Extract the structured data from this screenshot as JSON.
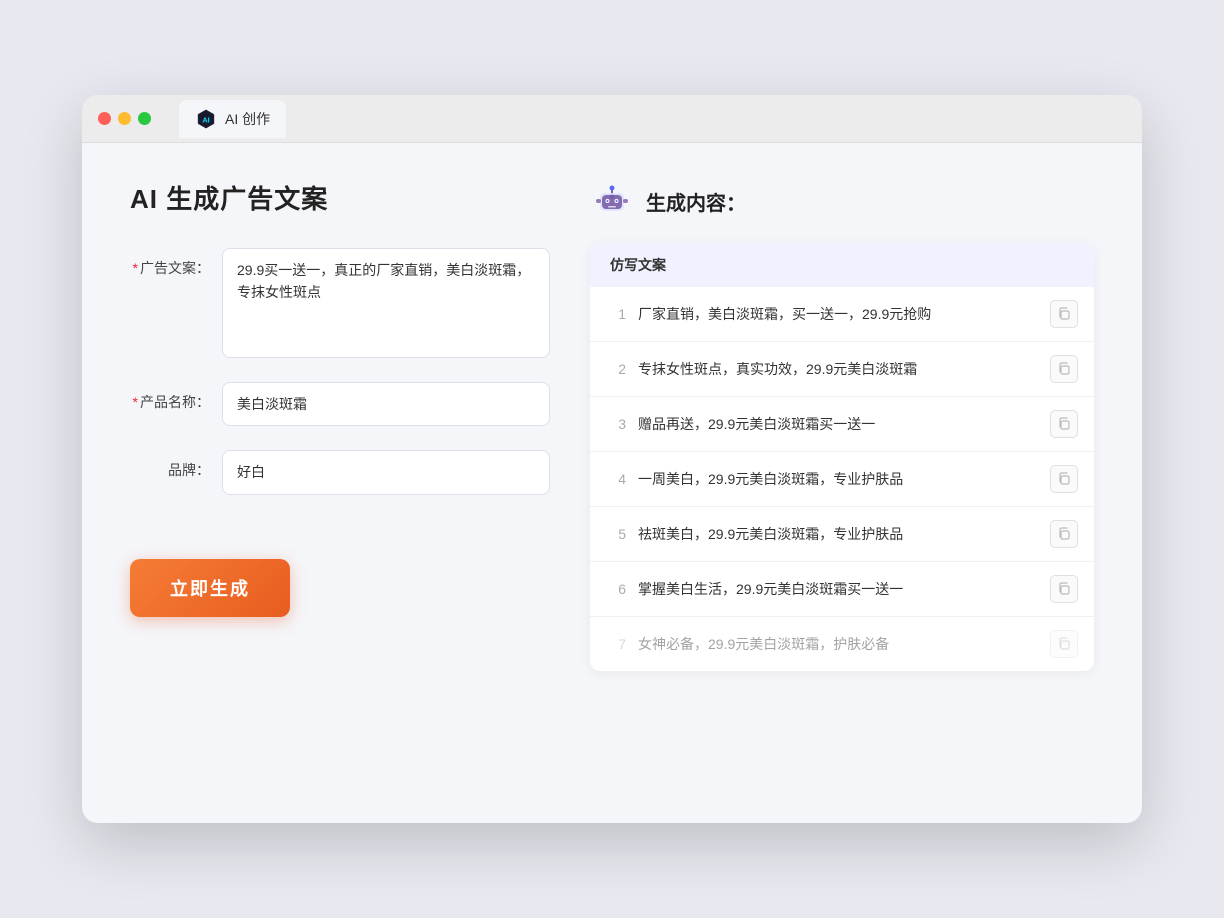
{
  "browser": {
    "tab_label": "AI 创作",
    "traffic_lights": [
      "red",
      "yellow",
      "green"
    ]
  },
  "left": {
    "page_title": "AI 生成广告文案",
    "form": {
      "ad_copy_label": "广告文案：",
      "ad_copy_required": "*",
      "ad_copy_value": "29.9买一送一，真正的厂家直销，美白淡斑霜，专抹女性斑点",
      "product_label": "产品名称：",
      "product_required": "*",
      "product_value": "美白淡斑霜",
      "brand_label": "品牌：",
      "brand_value": "好白",
      "generate_btn": "立即生成"
    }
  },
  "right": {
    "header_title": "生成内容：",
    "table_header": "仿写文案",
    "rows": [
      {
        "num": "1",
        "text": "厂家直销，美白淡斑霜，买一送一，29.9元抢购",
        "faded": false
      },
      {
        "num": "2",
        "text": "专抹女性斑点，真实功效，29.9元美白淡斑霜",
        "faded": false
      },
      {
        "num": "3",
        "text": "赠品再送，29.9元美白淡斑霜买一送一",
        "faded": false
      },
      {
        "num": "4",
        "text": "一周美白，29.9元美白淡斑霜，专业护肤品",
        "faded": false
      },
      {
        "num": "5",
        "text": "祛斑美白，29.9元美白淡斑霜，专业护肤品",
        "faded": false
      },
      {
        "num": "6",
        "text": "掌握美白生活，29.9元美白淡斑霜买一送一",
        "faded": false
      },
      {
        "num": "7",
        "text": "女神必备，29.9元美白淡斑霜，护肤必备",
        "faded": true
      }
    ]
  }
}
